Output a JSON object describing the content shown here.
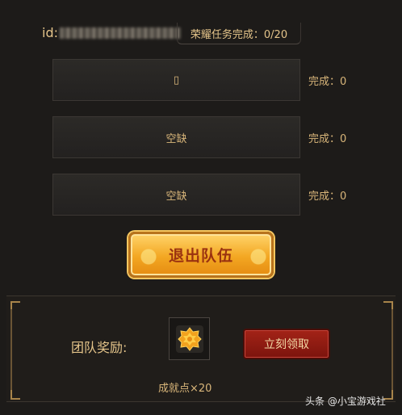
{
  "header": {
    "id_prefix": "id:",
    "task_progress": "荣耀任务完成：0/20"
  },
  "slots": [
    {
      "label": "▯",
      "status": "完成：0"
    },
    {
      "label": "空缺",
      "status": "完成：0"
    },
    {
      "label": "空缺",
      "status": "完成：0"
    }
  ],
  "quit_button_label": "退出队伍",
  "reward": {
    "label": "团队奖励:",
    "item_count": "成就点×20",
    "claim_label": "立刻领取",
    "item_icon": "octagon-star-badge-icon"
  },
  "watermark": "头条 @小宝游戏社",
  "colors": {
    "gold_text": "#d9b67a",
    "button_gold": "#f3a722",
    "button_red": "#8e1a11"
  }
}
